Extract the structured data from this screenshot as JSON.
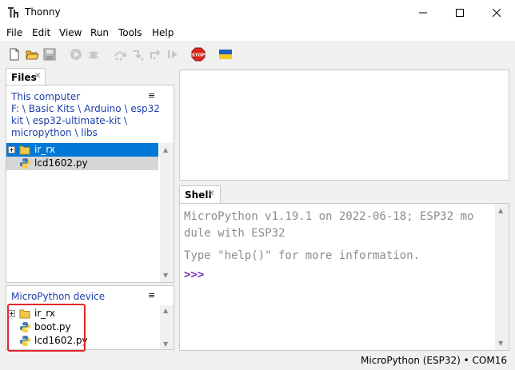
{
  "window": {
    "title": "Thonny",
    "minimize_glyph": "—",
    "maximize_glyph": "☐",
    "close_glyph": "✕"
  },
  "menu": [
    "File",
    "Edit",
    "View",
    "Run",
    "Tools",
    "Help"
  ],
  "toolbar": {
    "icons": [
      "new-file-icon",
      "open-file-icon",
      "save-icon",
      "run-icon",
      "debug-icon",
      "step-over-icon",
      "step-into-icon",
      "step-out-icon",
      "resume-icon",
      "stop-icon",
      "ukraine-flag-icon"
    ],
    "stop_label": "STOP"
  },
  "files": {
    "tab_label": "Files",
    "tab_close": "✕",
    "this_computer": {
      "title": "This computer",
      "menu_glyph": "≡",
      "path_parts": [
        "F:",
        "Basic Kits",
        "Arduino",
        "esp32 kit",
        "esp32-ultimate-kit",
        "micropython",
        "libs"
      ],
      "separator": "\\",
      "items": [
        {
          "name": "ir_rx",
          "type": "folder",
          "state": "selected"
        },
        {
          "name": "lcd1602.py",
          "type": "python",
          "state": "hover"
        }
      ]
    },
    "device": {
      "title": "MicroPython device",
      "menu_glyph": "≡",
      "items": [
        {
          "name": "ir_rx",
          "type": "folder"
        },
        {
          "name": "boot.py",
          "type": "python"
        },
        {
          "name": "lcd1602.py",
          "type": "python"
        }
      ]
    }
  },
  "shell": {
    "tab_label": "Shell",
    "tab_close": "✕",
    "lines": [
      "MicroPython v1.19.1 on 2022-06-18; ESP32 mo",
      "dule with ESP32",
      "Type \"help()\" for more information."
    ],
    "prompt": ">>>"
  },
  "status": {
    "interpreter": "MicroPython (ESP32)",
    "separator": "•",
    "port": "COM16"
  },
  "colors": {
    "accent_blue": "#0078d7",
    "link_blue": "#1c3faa",
    "highlight_red": "#e3262a",
    "prompt_purple": "#7b2fb5"
  }
}
